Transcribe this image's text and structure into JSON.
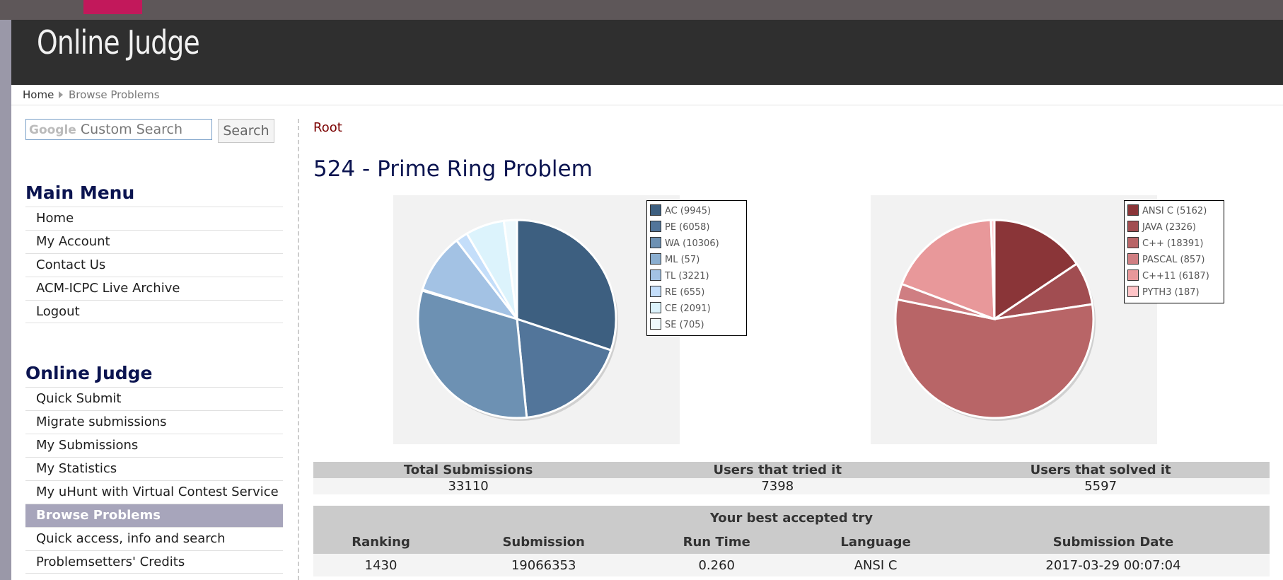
{
  "app": {
    "logo": "Online Judge"
  },
  "breadcrumb": {
    "home": "Home",
    "current": "Browse Problems"
  },
  "search": {
    "brand": "Google",
    "placeholder": "Custom Search",
    "button": "Search"
  },
  "main_menu": {
    "title": "Main Menu",
    "items": [
      "Home",
      "My Account",
      "Contact Us",
      "ACM-ICPC Live Archive",
      "Logout"
    ]
  },
  "oj_menu": {
    "title": "Online Judge",
    "items": [
      "Quick Submit",
      "Migrate submissions",
      "My Submissions",
      "My Statistics",
      "My uHunt with Virtual Contest Service",
      "Browse Problems",
      "Quick access, info and search",
      "Problemsetters' Credits"
    ],
    "active_index": 5
  },
  "content": {
    "root_link": "Root",
    "problem_title": "524 - Prime Ring Problem"
  },
  "chart_data": [
    {
      "type": "pie",
      "categories": [
        "AC (9945)",
        "PE (6058)",
        "WA (10306)",
        "ML (57)",
        "TL (3221)",
        "RE (655)",
        "CE (2091)",
        "SE (705)"
      ],
      "values": [
        9945,
        6058,
        10306,
        57,
        3221,
        655,
        2091,
        705
      ],
      "colors": [
        "#3d5f80",
        "#52759a",
        "#6d91b3",
        "#8aaed0",
        "#a3c2e4",
        "#c4defa",
        "#dcf3fc",
        "#eef9fd"
      ],
      "legend": "top-right"
    },
    {
      "type": "pie",
      "categories": [
        "ANSI C (5162)",
        "JAVA (2326)",
        "C++ (18391)",
        "PASCAL (857)",
        "C++11 (6187)",
        "PYTH3 (187)"
      ],
      "values": [
        5162,
        2326,
        18391,
        857,
        6187,
        187
      ],
      "colors": [
        "#8a3538",
        "#a14d51",
        "#b86567",
        "#cf7e82",
        "#e8989a",
        "#ffc4c7"
      ],
      "legend": "top-right"
    }
  ],
  "summary": {
    "headers": [
      "Total Submissions",
      "Users that tried it",
      "Users that solved it"
    ],
    "values": [
      "33110",
      "7398",
      "5597"
    ]
  },
  "best_try": {
    "title": "Your best accepted try",
    "headers": [
      "Ranking",
      "Submission",
      "Run Time",
      "Language",
      "Submission Date"
    ],
    "values": [
      "1430",
      "19066353",
      "0.260",
      "ANSI C",
      "2017-03-29 00:07:04"
    ]
  }
}
